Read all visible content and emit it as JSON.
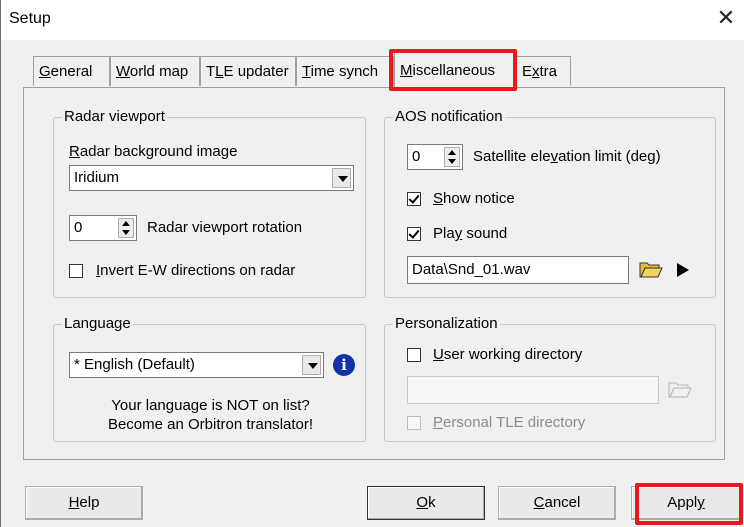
{
  "window": {
    "title": "Setup",
    "close_glyph": "✕"
  },
  "tabs": [
    {
      "pre": "",
      "accel": "G",
      "post": "eneral"
    },
    {
      "pre": "",
      "accel": "W",
      "post": "orld map"
    },
    {
      "pre": "T",
      "accel": "L",
      "post": "E updater"
    },
    {
      "pre": "",
      "accel": "T",
      "post": "ime synch"
    },
    {
      "pre": "",
      "accel": "M",
      "post": "iscellaneous"
    },
    {
      "pre": "E",
      "accel": "x",
      "post": "tra"
    }
  ],
  "active_tab": "Miscellaneous",
  "radar": {
    "title": "Radar viewport",
    "bg_label_accel": "R",
    "bg_label_rest": "adar background image",
    "bg_value": "Iridium",
    "rotation_value": "0",
    "rotation_label": "Radar viewport rotation",
    "invert_accel": "I",
    "invert_rest": "nvert E-W directions on radar",
    "invert_checked": false
  },
  "aos": {
    "title": "AOS notification",
    "elev_value": "0",
    "elev_pre": "Satellite ele",
    "elev_accel": "v",
    "elev_post": "ation limit (deg)",
    "show_accel": "S",
    "show_rest": "how notice",
    "show_checked": true,
    "play_pre": "Pla",
    "play_accel": "y",
    "play_post": " sound",
    "play_checked": true,
    "sound_file": "Data\\Snd_01.wav"
  },
  "language": {
    "title": "Language",
    "value": "* English (Default)",
    "note_line1": "Your language is NOT on list?",
    "note_line2": "Become an Orbitron translator!"
  },
  "personalization": {
    "title": "Personalization",
    "user_dir_accel": "U",
    "user_dir_rest": "ser working directory",
    "user_dir_checked": false,
    "user_dir_value": "",
    "tle_dir_accel": "P",
    "tle_dir_rest": "ersonal TLE directory",
    "tle_dir_checked": false
  },
  "buttons": {
    "help_accel": "H",
    "help_rest": "elp",
    "ok_accel": "O",
    "ok_rest": "k",
    "cancel_accel": "C",
    "cancel_rest": "ancel",
    "apply_pre": "Appl",
    "apply_accel": "y"
  },
  "colors": {
    "highlight": "#e8191c",
    "info_icon": "#1133a8",
    "window_bg": "#f0f0f0"
  }
}
